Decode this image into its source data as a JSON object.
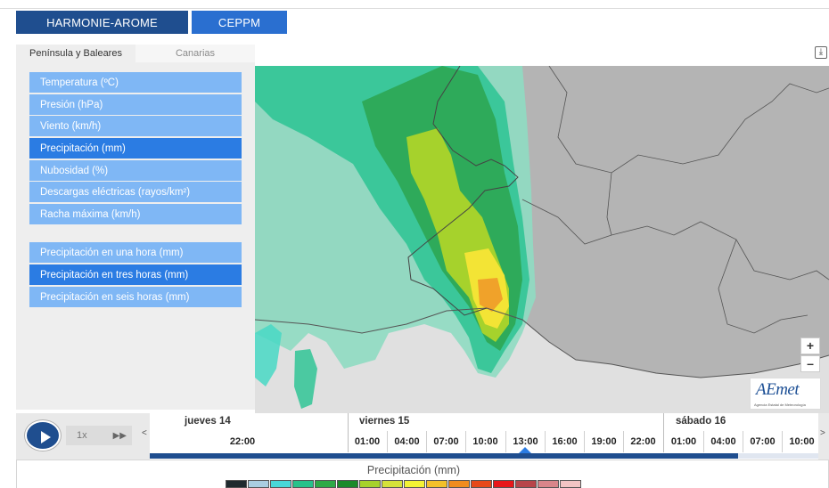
{
  "header": {
    "model_tabs": [
      {
        "label": "HARMONIE-AROME",
        "active": true
      },
      {
        "label": "CEPPM",
        "active": false
      }
    ]
  },
  "sidebar": {
    "region_tabs": [
      {
        "label": "Península y Baleares",
        "active": true
      },
      {
        "label": "Canarias",
        "active": false
      }
    ],
    "variables": [
      {
        "label": "Temperatura (ºC)",
        "selected": false
      },
      {
        "label": "Presión (hPa)",
        "selected": false
      },
      {
        "label": "Viento (km/h)",
        "selected": false
      },
      {
        "label": "Precipitación (mm)",
        "selected": true
      },
      {
        "label": "Nubosidad (%)",
        "selected": false
      },
      {
        "label": "Descargas eléctricas (rayos/km²)",
        "selected": false
      },
      {
        "label": "Racha máxima (km/h)",
        "selected": false
      }
    ],
    "accumulations": [
      {
        "label": "Precipitación en una hora (mm)",
        "selected": false
      },
      {
        "label": "Precipitación en tres horas (mm)",
        "selected": true
      },
      {
        "label": "Precipitación en seis horas (mm)",
        "selected": false
      }
    ]
  },
  "map": {
    "zoom_in": "+",
    "zoom_out": "–",
    "download_icon": "download-icon",
    "logo_text": "AEmet",
    "logo_subtitle": "Agencia Estatal de Meteorología"
  },
  "player": {
    "speed": "1x",
    "fast_forward": "▶▶",
    "prev": "<",
    "next": ">",
    "days": [
      {
        "label": "jueves 14"
      },
      {
        "label": "viernes 15"
      },
      {
        "label": "sábado 16"
      }
    ],
    "hours": [
      "22:00",
      "01:00",
      "04:00",
      "07:00",
      "10:00",
      "13:00",
      "16:00",
      "19:00",
      "22:00",
      "01:00",
      "04:00",
      "07:00",
      "10:00"
    ],
    "current_hour": "13:00",
    "progress": 0.88
  },
  "legend": {
    "title": "Precipitación (mm)",
    "colors": [
      "#1f2a2e",
      "#a9cde0",
      "#48d8d8",
      "#27c28a",
      "#2eaa46",
      "#1b8a2a",
      "#a6d22c",
      "#d5e23a",
      "#f3f335",
      "#f3c12a",
      "#f08c1e",
      "#e6491a",
      "#e8171a",
      "#b7454a",
      "#d8858a",
      "#f2c4c4"
    ]
  }
}
